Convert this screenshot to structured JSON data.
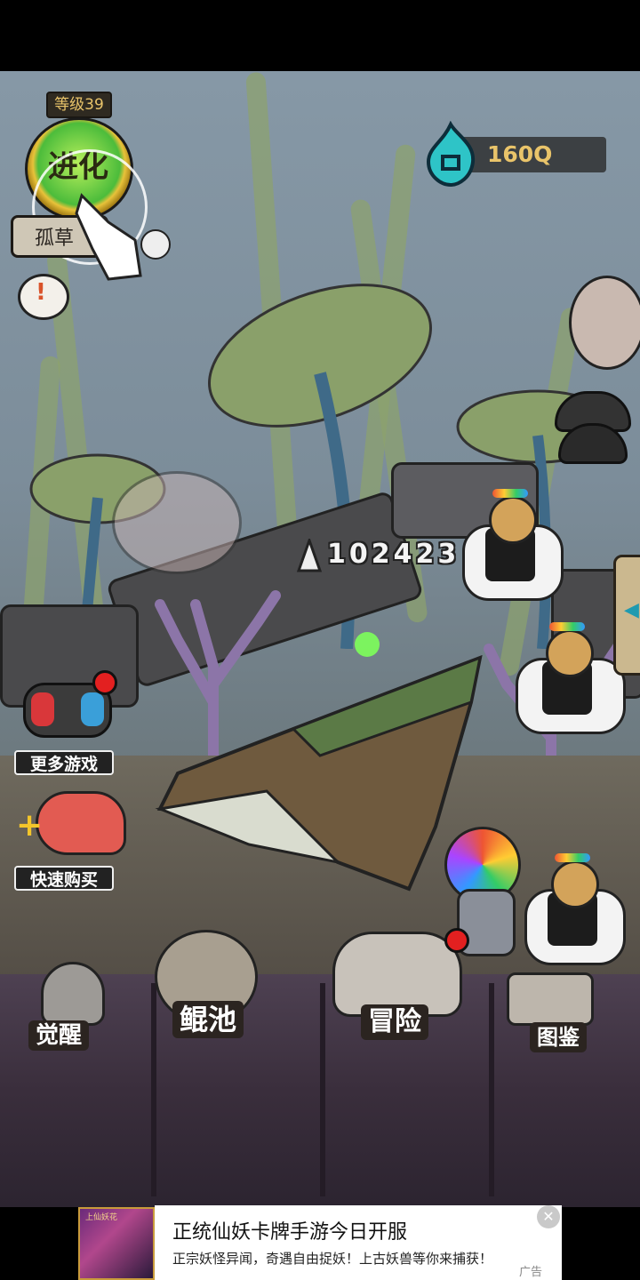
{
  "hud": {
    "level_label": "等级39",
    "evolve_label": "进化",
    "character_name": "孤草",
    "currency_value": "160Q"
  },
  "battle": {
    "damage_number": "102423"
  },
  "side_menu": {
    "more_games": "更多游戏",
    "quick_buy": "快速购买"
  },
  "bottom_menu": {
    "awaken": "觉醒",
    "kun_pool": "鲲池",
    "adventure": "冒险",
    "codex": "图鉴"
  },
  "ad": {
    "thumb_text": "上仙妖花",
    "title": "正统仙妖卡牌手游今日开服",
    "subtitle": "正宗妖怪异闻，奇遇自由捉妖！上古妖兽等你来捕获！",
    "close_symbol": "✕",
    "tag": "广告"
  },
  "colors": {
    "accent_gold": "#e9c46a",
    "currency_teal": "#2ec4c7",
    "alert_red": "#e32020"
  }
}
